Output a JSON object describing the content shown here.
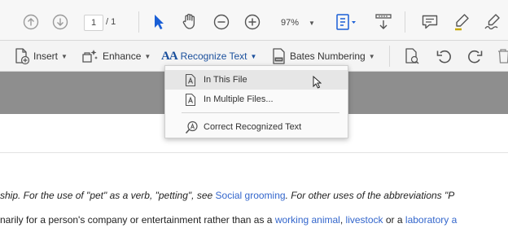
{
  "toolbar": {
    "page_current": "1",
    "page_total": "/ 1",
    "zoom": "97%"
  },
  "toolbar2": {
    "insert": "Insert",
    "enhance": "Enhance",
    "recognize": "Recognize Text",
    "bates": "Bates Numbering"
  },
  "menu": {
    "items": [
      {
        "label": "In This File"
      },
      {
        "label": "In Multiple Files..."
      },
      {
        "label": "Correct Recognized Text"
      }
    ]
  },
  "document": {
    "line1": {
      "pre": "ship. For the use of \"pet\" as a verb, \"petting\", see ",
      "link1": "Social grooming",
      "post": ". For other uses of the abbreviations \"P"
    },
    "line2": {
      "pre": "narily for a person's company or entertainment rather than as a ",
      "link1": "working animal",
      "sep1": ", ",
      "link2": "livestock",
      "sep2": " or a ",
      "link3": "laboratory a"
    }
  },
  "colors": {
    "accent": "#1a4f9c",
    "link": "#3366cc",
    "cursor_blue": "#1a5fd6",
    "gray_band": "#8e8e8e"
  }
}
